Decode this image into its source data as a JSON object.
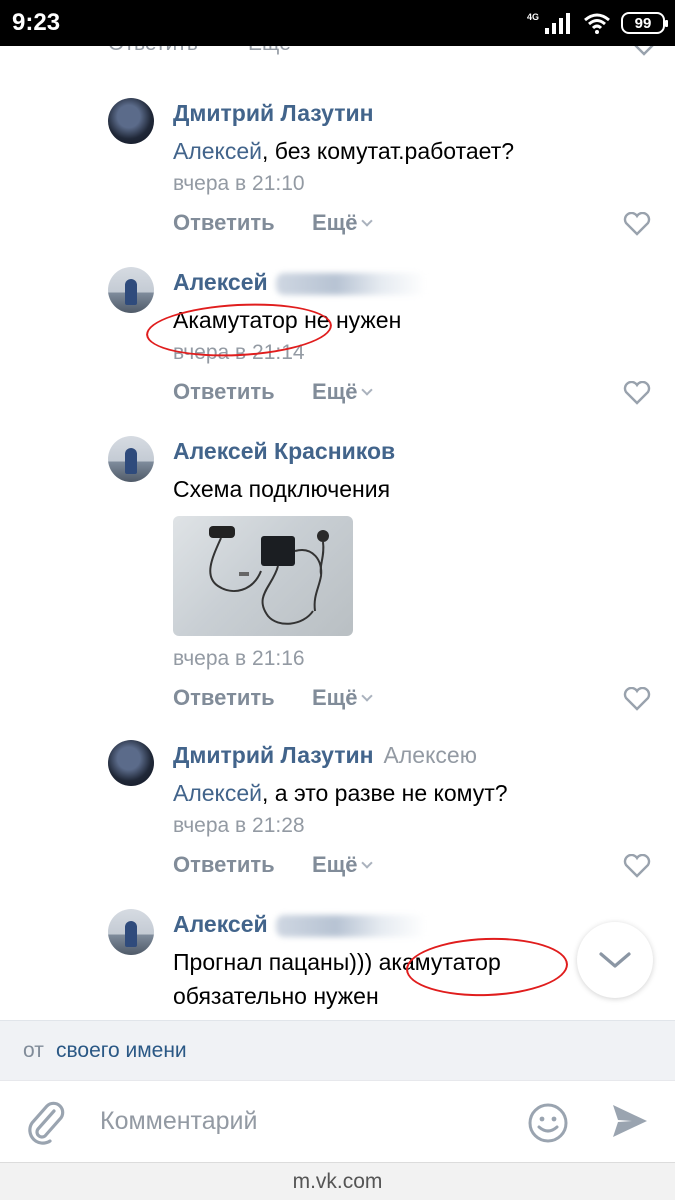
{
  "status_bar": {
    "time": "9:23",
    "network": "4G",
    "battery": "99"
  },
  "feed": {
    "top_partial": {
      "reply_label": "Ответить",
      "more_label": "Ещё"
    },
    "comments": [
      {
        "author": "Дмитрий Лазутин",
        "mention": "Алексей",
        "text": ", без комутат.работает?",
        "time": "вчера в 21:10",
        "reply_label": "Ответить",
        "more_label": "Ещё"
      },
      {
        "author": "Алексей",
        "text": "Акамутатор не нужен",
        "time": "вчера в 21:14",
        "reply_label": "Ответить",
        "more_label": "Ещё"
      },
      {
        "author": "Алексей Красников",
        "text": "Схема подключения",
        "time": "вчера в 21:16",
        "reply_label": "Ответить",
        "more_label": "Ещё"
      },
      {
        "author": "Дмитрий Лазутин",
        "reply_to": "Алексею",
        "mention": "Алексей",
        "text": ", а это разве не комут?",
        "time": "вчера в 21:28",
        "reply_label": "Ответить",
        "more_label": "Ещё"
      },
      {
        "author": "Алексей",
        "text_line1": "Прогнал пацаны))) акамутатор",
        "text_line2": "обязательно нужен"
      }
    ]
  },
  "post_as": {
    "prefix": "от",
    "name": "своего имени"
  },
  "composer": {
    "placeholder": "Комментарий"
  },
  "browser": {
    "url": "m.vk.com"
  },
  "colors": {
    "author": "#42648b",
    "link": "#2a5885",
    "secondary": "#939aa3",
    "annotation": "#e01d1d"
  }
}
